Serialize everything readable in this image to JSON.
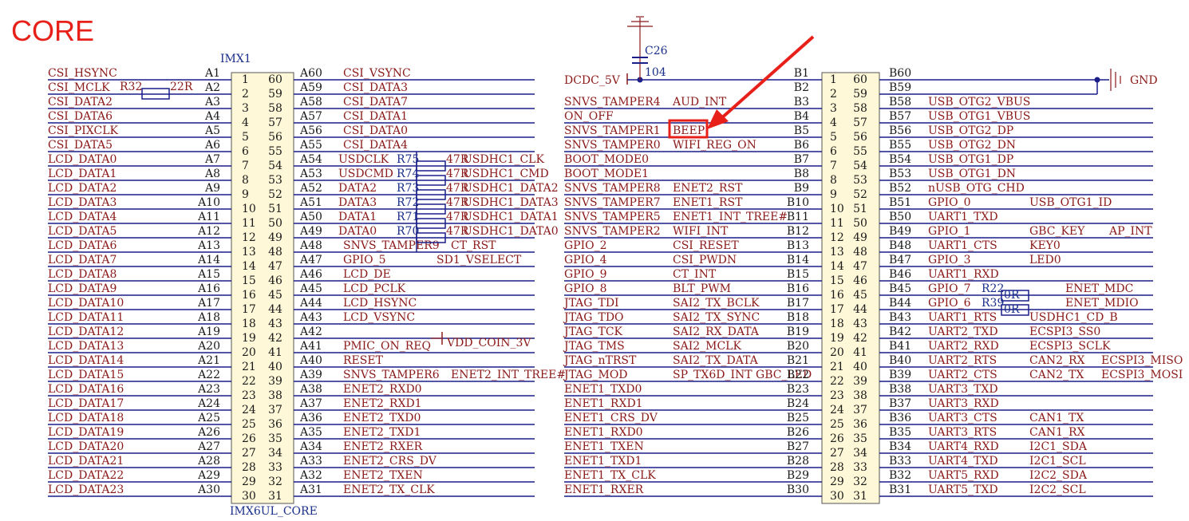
{
  "page": {
    "title": "CORE"
  },
  "chip": {
    "designator": "IMX1",
    "part": "IMX6UL_CORE"
  },
  "left_pins_a": [
    {
      "net": "CSI_HSYNC",
      "pin": "A1"
    },
    {
      "net": "CSI_MCLK",
      "pin": "A2"
    },
    {
      "net": "CSI_DATA2",
      "pin": "A3"
    },
    {
      "net": "CSI_DATA6",
      "pin": "A4"
    },
    {
      "net": "CSI_PIXCLK",
      "pin": "A5"
    },
    {
      "net": "CSI_DATA5",
      "pin": "A6"
    },
    {
      "net": "LCD_DATA0",
      "pin": "A7"
    },
    {
      "net": "LCD_DATA1",
      "pin": "A8"
    },
    {
      "net": "LCD_DATA2",
      "pin": "A9"
    },
    {
      "net": "LCD_DATA3",
      "pin": "A10"
    },
    {
      "net": "LCD_DATA4",
      "pin": "A11"
    },
    {
      "net": "LCD_DATA5",
      "pin": "A12"
    },
    {
      "net": "LCD_DATA6",
      "pin": "A13"
    },
    {
      "net": "LCD_DATA7",
      "pin": "A14"
    },
    {
      "net": "LCD_DATA8",
      "pin": "A15"
    },
    {
      "net": "LCD_DATA9",
      "pin": "A16"
    },
    {
      "net": "LCD_DATA10",
      "pin": "A17"
    },
    {
      "net": "LCD_DATA11",
      "pin": "A18"
    },
    {
      "net": "LCD_DATA12",
      "pin": "A19"
    },
    {
      "net": "LCD_DATA13",
      "pin": "A20"
    },
    {
      "net": "LCD_DATA14",
      "pin": "A21"
    },
    {
      "net": "LCD_DATA15",
      "pin": "A22"
    },
    {
      "net": "LCD_DATA16",
      "pin": "A23"
    },
    {
      "net": "LCD_DATA17",
      "pin": "A24"
    },
    {
      "net": "LCD_DATA18",
      "pin": "A25"
    },
    {
      "net": "LCD_DATA19",
      "pin": "A26"
    },
    {
      "net": "LCD_DATA20",
      "pin": "A27"
    },
    {
      "net": "LCD_DATA21",
      "pin": "A28"
    },
    {
      "net": "LCD_DATA22",
      "pin": "A29"
    },
    {
      "net": "LCD_DATA23",
      "pin": "A30"
    }
  ],
  "right_pins_a": [
    {
      "pin": "A60",
      "net": "CSI_VSYNC"
    },
    {
      "pin": "A59",
      "net": "CSI_DATA3"
    },
    {
      "pin": "A58",
      "net": "CSI_DATA7"
    },
    {
      "pin": "A57",
      "net": "CSI_DATA1"
    },
    {
      "pin": "A56",
      "net": "CSI_DATA0"
    },
    {
      "pin": "A55",
      "net": "CSI_DATA4"
    },
    {
      "pin": "A54",
      "net": "USDCLK"
    },
    {
      "pin": "A53",
      "net": "USDCMD"
    },
    {
      "pin": "A52",
      "net": "DATA2"
    },
    {
      "pin": "A51",
      "net": "DATA3"
    },
    {
      "pin": "A50",
      "net": "DATA1"
    },
    {
      "pin": "A49",
      "net": "DATA0"
    },
    {
      "pin": "A48",
      "net": "SNVS_TAMPER9"
    },
    {
      "pin": "A47",
      "net": "GPIO_5"
    },
    {
      "pin": "A46",
      "net": "LCD_DE"
    },
    {
      "pin": "A45",
      "net": "LCD_PCLK"
    },
    {
      "pin": "A44",
      "net": "LCD_HSYNC"
    },
    {
      "pin": "A43",
      "net": "LCD_VSYNC"
    },
    {
      "pin": "A42",
      "net": ""
    },
    {
      "pin": "A41",
      "net": "PMIC_ON_REQ"
    },
    {
      "pin": "A40",
      "net": "RESET"
    },
    {
      "pin": "A39",
      "net": "SNVS_TAMPER6"
    },
    {
      "pin": "A38",
      "net": "ENET2_RXD0"
    },
    {
      "pin": "A37",
      "net": "ENET2_RXD1"
    },
    {
      "pin": "A36",
      "net": "ENET2_TXD0"
    },
    {
      "pin": "A35",
      "net": "ENET2_TXD1"
    },
    {
      "pin": "A34",
      "net": "ENET2_RXER"
    },
    {
      "pin": "A33",
      "net": "ENET2_CRS_DV"
    },
    {
      "pin": "A32",
      "net": "ENET2_TXEN"
    },
    {
      "pin": "A31",
      "net": "ENET2_TX_CLK"
    }
  ],
  "a_series_resistors": [
    {
      "ref": "R75",
      "value": "47R",
      "net": "USDHC1_CLK"
    },
    {
      "ref": "R74",
      "value": "47R",
      "net": "USDHC1_CMD"
    },
    {
      "ref": "R73",
      "value": "47R",
      "net": "USDHC1_DATA2"
    },
    {
      "ref": "R72",
      "value": "47R",
      "net": "USDHC1_DATA3"
    },
    {
      "ref": "R71",
      "value": "47R",
      "net": "USDHC1_DATA1"
    },
    {
      "ref": "R70",
      "value": "47R",
      "net": "USDHC1_DATA0"
    }
  ],
  "a_right_extra": {
    "ct_rst": "CT_RST",
    "sd1_vselect": "SD1_VSELECT",
    "vdd_coin": "VDD_COIN_3V",
    "enet2_int": "ENET2_INT_TREE#"
  },
  "r32": {
    "ref": "R32",
    "value": "22R"
  },
  "left_pins_b": [
    {
      "net": "",
      "func": "",
      "pin": "B1"
    },
    {
      "net": "",
      "func": "",
      "pin": "B2"
    },
    {
      "net": "SNVS_TAMPER4",
      "func": "AUD_INT",
      "pin": "B3"
    },
    {
      "net": "ON_OFF",
      "func": "",
      "pin": "B4"
    },
    {
      "net": "SNVS_TAMPER1",
      "func": "BEEP",
      "pin": "B5"
    },
    {
      "net": "SNVS_TAMPER0",
      "func": "WIFI_REG_ON",
      "pin": "B6"
    },
    {
      "net": "BOOT_MODE0",
      "func": "",
      "pin": "B7"
    },
    {
      "net": "BOOT_MODE1",
      "func": "",
      "pin": "B8"
    },
    {
      "net": "SNVS_TAMPER8",
      "func": "ENET2_RST",
      "pin": "B9"
    },
    {
      "net": "SNVS_TAMPER7",
      "func": "ENET1_RST",
      "pin": "B10"
    },
    {
      "net": "SNVS_TAMPER5",
      "func": "ENET1_INT_TREE#",
      "pin": "B11"
    },
    {
      "net": "SNVS_TAMPER2",
      "func": "WIFI_INT",
      "pin": "B12"
    },
    {
      "net": "GPIO_2",
      "func": "CSI_RESET",
      "pin": "B13"
    },
    {
      "net": "GPIO_4",
      "func": "CSI_PWDN",
      "pin": "B14"
    },
    {
      "net": "GPIO_9",
      "func": "CT_INT",
      "pin": "B15"
    },
    {
      "net": "GPIO_8",
      "func": "BLT_PWM",
      "pin": "B16"
    },
    {
      "net": "JTAG_TDI",
      "func": "SAI2_TX_BCLK",
      "pin": "B17"
    },
    {
      "net": "JTAG_TDO",
      "func": "SAI2_TX_SYNC",
      "pin": "B18"
    },
    {
      "net": "JTAG_TCK",
      "func": "SAI2_RX_DATA",
      "pin": "B19"
    },
    {
      "net": "JTAG_TMS",
      "func": "SAI2_MCLK",
      "pin": "B20"
    },
    {
      "net": "JTAG_nTRST",
      "func": "SAI2_TX_DATA",
      "pin": "B21"
    },
    {
      "net": "JTAG_MOD",
      "func": "SP_TX6D_INT  GBC_LED",
      "pin": "B22"
    },
    {
      "net": "ENET1_TXD0",
      "func": "",
      "pin": "B23"
    },
    {
      "net": "ENET1_RXD1",
      "func": "",
      "pin": "B24"
    },
    {
      "net": "ENET1_CRS_DV",
      "func": "",
      "pin": "B25"
    },
    {
      "net": "ENET1_RXD0",
      "func": "",
      "pin": "B26"
    },
    {
      "net": "ENET1_TXEN",
      "func": "",
      "pin": "B27"
    },
    {
      "net": "ENET1_TXD1",
      "func": "",
      "pin": "B28"
    },
    {
      "net": "ENET1_TX_CLK",
      "func": "",
      "pin": "B29"
    },
    {
      "net": "ENET1_RXER",
      "func": "",
      "pin": "B30"
    }
  ],
  "right_pins_b": [
    {
      "pin": "B60",
      "net": "",
      "f1": "",
      "f2": ""
    },
    {
      "pin": "B59",
      "net": "",
      "f1": "",
      "f2": ""
    },
    {
      "pin": "B58",
      "net": "USB_OTG2_VBUS",
      "f1": "",
      "f2": ""
    },
    {
      "pin": "B57",
      "net": "USB_OTG1_VBUS",
      "f1": "",
      "f2": ""
    },
    {
      "pin": "B56",
      "net": "USB_OTG2_DP",
      "f1": "",
      "f2": ""
    },
    {
      "pin": "B55",
      "net": "USB_OTG2_DN",
      "f1": "",
      "f2": ""
    },
    {
      "pin": "B54",
      "net": "USB_OTG1_DP",
      "f1": "",
      "f2": ""
    },
    {
      "pin": "B53",
      "net": "USB_OTG1_DN",
      "f1": "",
      "f2": ""
    },
    {
      "pin": "B52",
      "net": "nUSB_OTG_CHD",
      "f1": "",
      "f2": ""
    },
    {
      "pin": "B51",
      "net": "GPIO_0",
      "f1": "USB_OTG1_ID",
      "f2": ""
    },
    {
      "pin": "B50",
      "net": "UART1_TXD",
      "f1": "",
      "f2": ""
    },
    {
      "pin": "B49",
      "net": "GPIO_1",
      "f1": "GBC_KEY",
      "f2": "AP_INT"
    },
    {
      "pin": "B48",
      "net": "UART1_CTS",
      "f1": "KEY0",
      "f2": ""
    },
    {
      "pin": "B47",
      "net": "GPIO_3",
      "f1": "LED0",
      "f2": ""
    },
    {
      "pin": "B46",
      "net": "UART1_RXD",
      "f1": "",
      "f2": ""
    },
    {
      "pin": "B45",
      "net": "GPIO_7",
      "f1": "ENET_MDC",
      "f2": ""
    },
    {
      "pin": "B44",
      "net": "GPIO_6",
      "f1": "ENET_MDIO",
      "f2": ""
    },
    {
      "pin": "B43",
      "net": "UART1_RTS",
      "f1": "USDHC1_CD_B",
      "f2": ""
    },
    {
      "pin": "B42",
      "net": "UART2_TXD",
      "f1": "ECSPI3_SS0",
      "f2": ""
    },
    {
      "pin": "B41",
      "net": "UART2_RXD",
      "f1": "ECSPI3_SCLK",
      "f2": ""
    },
    {
      "pin": "B40",
      "net": "UART2_RTS",
      "f1": "CAN2_RX",
      "f2": "ECSPI3_MISO"
    },
    {
      "pin": "B39",
      "net": "UART2_CTS",
      "f1": "CAN2_TX",
      "f2": "ECSPI3_MOSI"
    },
    {
      "pin": "B38",
      "net": "UART3_TXD",
      "f1": "",
      "f2": ""
    },
    {
      "pin": "B37",
      "net": "UART3_RXD",
      "f1": "",
      "f2": ""
    },
    {
      "pin": "B36",
      "net": "UART3_CTS",
      "f1": "CAN1_TX",
      "f2": ""
    },
    {
      "pin": "B35",
      "net": "UART3_RTS",
      "f1": "CAN1_RX",
      "f2": ""
    },
    {
      "pin": "B34",
      "net": "UART4_RXD",
      "f1": "I2C1_SDA",
      "f2": ""
    },
    {
      "pin": "B33",
      "net": "UART4_TXD",
      "f1": "I2C1_SCL",
      "f2": ""
    },
    {
      "pin": "B32",
      "net": "UART5_RXD",
      "f1": "I2C2_SDA",
      "f2": ""
    },
    {
      "pin": "B31",
      "net": "UART5_TXD",
      "f1": "I2C2_SCL",
      "f2": ""
    }
  ],
  "b_resistors": [
    {
      "ref": "R22",
      "value": "0R"
    },
    {
      "ref": "R39",
      "value": "0R"
    }
  ],
  "power": {
    "dcdc": "DCDC_5V",
    "cap_ref": "C26",
    "cap_value": "104",
    "gnd": "GND"
  },
  "highlight": {
    "label": "BEEP",
    "color": "#e8201a"
  },
  "colors": {
    "net": "#8b1a1a",
    "wire": "#1a1f8a",
    "pin": "#1a1a1a",
    "box_fill": "#fff8d8",
    "title": "#e8201a"
  }
}
